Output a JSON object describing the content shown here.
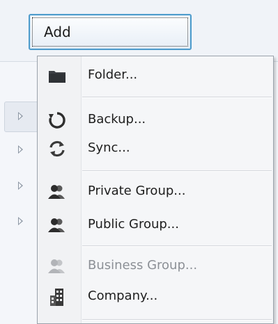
{
  "toolbar": {
    "add_label": "Add"
  },
  "menu": {
    "items": [
      {
        "label": "Folder...",
        "icon": "folder-icon",
        "enabled": true
      },
      {
        "label": "Backup...",
        "icon": "backup-icon",
        "enabled": true
      },
      {
        "label": "Sync...",
        "icon": "sync-icon",
        "enabled": true
      },
      {
        "label": "Private Group...",
        "icon": "private-group-icon",
        "enabled": true
      },
      {
        "label": "Public Group...",
        "icon": "public-group-icon",
        "enabled": true
      },
      {
        "label": "Business Group...",
        "icon": "business-group-icon",
        "enabled": false
      },
      {
        "label": "Company...",
        "icon": "company-icon",
        "enabled": true
      }
    ]
  },
  "colors": {
    "button_border": "#4f9ccc",
    "menu_border": "#9aa2ab",
    "disabled_text": "#8c9096",
    "icon_dark": "#3a3a3a"
  }
}
